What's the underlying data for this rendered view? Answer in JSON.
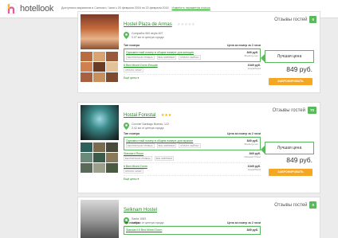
{
  "header": {
    "logo_text": "hotellook",
    "search_info": "Доступного вариантов в Сантьяго, Чили с 20 февраля 2016 по 22 февраля 2016",
    "change_link": "Изменить параметры поиска"
  },
  "labels": {
    "reviews": "Отзывы гостей",
    "col_room": "Тип номера",
    "col_price": "Цена за номер за 2 ночи",
    "best_price": "Лучшая цена",
    "book": "ЗАБРОНИРОВАТЬ"
  },
  "hotels": [
    {
      "name": "Hostel Plaza de Armas",
      "stars": "★★★★★",
      "address": "Compañía 960 depto 607",
      "distance": "0.07 км от центра города",
      "score": "0",
      "best_price": "849 руб.",
      "more": "Ещё цены ▾",
      "offers": [
        {
          "name": "Одноместный номер в общем номере для женщин",
          "tags": [
            "БЕСПЛАТНАЯ ОТМЕНА",
            "ВСЕ ЗАВТРАКИ",
            "ОПЛАТА СЕЙЧАС"
          ],
          "price": "849 руб.",
          "source": "Booking.com"
        },
        {
          "name": "6 Bed Mixed Dorm Ensuite",
          "tags": [
            "ОПЛАТА СРАЗУ"
          ],
          "price": "1049 руб.",
          "source": "HostelWorld"
        }
      ]
    },
    {
      "name": "Hostal Forestal",
      "stars": "★★★",
      "address": "Coronel Santiago Bueras, 122",
      "distance": "2.42 км от центра города",
      "score": "70",
      "best_price": "849 руб.",
      "more": "Ещё цены ▾",
      "offers": [
        {
          "name": "Одноместный номер в общем номере для мужчин",
          "tags": [
            "БЕСПЛАТНАЯ ОТМЕНА",
            "ВСЕ ЗАВТРАКИ",
            "ОПЛАТА СЕЙЧАС"
          ],
          "price": "849 руб.",
          "source": "Booking.com"
        },
        {
          "name": "Standard Room",
          "tags": [
            "БЕСПЛАТНАЯ ОТМЕНА",
            "ВСЕ ЗАВТРАКИ"
          ],
          "price": "849 руб.",
          "source": "Связной Travel"
        },
        {
          "name": "6 Bed Mixed Dorm",
          "tags": [
            "ОПЛАТА СРАЗУ"
          ],
          "price": "1049 руб.",
          "source": "HostelWorld"
        }
      ]
    },
    {
      "name": "Selknam Hostel",
      "stars": "",
      "address": "Santa 1083",
      "distance": "1.48 км от центра города",
      "score": "0",
      "offers": [
        {
          "name": "Standard 8 Bed Mixed Dorm",
          "tags": [],
          "price": "849 руб.",
          "source": ""
        }
      ]
    }
  ],
  "colors": {
    "accent_green": "#5cb85c",
    "button_orange": "#f5a623",
    "link_green": "#1a8a1a"
  }
}
